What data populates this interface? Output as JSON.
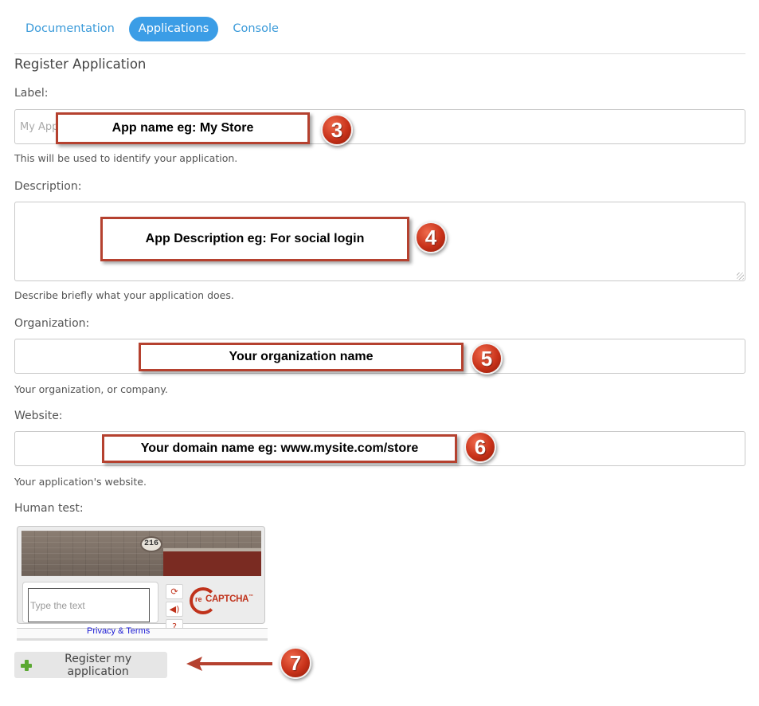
{
  "nav": {
    "tabs": [
      {
        "label": "Documentation",
        "active": false
      },
      {
        "label": "Applications",
        "active": true
      },
      {
        "label": "Console",
        "active": false
      }
    ]
  },
  "form": {
    "section_title": "Register Application",
    "label": {
      "label": "Label:",
      "placeholder": "My App",
      "help": "This will be used to identify your application."
    },
    "description": {
      "label": "Description:",
      "help": "Describe briefly what your application does."
    },
    "organization": {
      "label": "Organization:",
      "help": "Your organization, or company."
    },
    "website": {
      "label": "Website:",
      "help": "Your application's website."
    },
    "human_test": {
      "label": "Human test:",
      "house_number": "216",
      "input_placeholder": "Type the text",
      "logo_text": "reCAPTCHA",
      "logo_prefix": "re",
      "logo_main": "CAPTCHA",
      "logo_tm": "™",
      "privacy_link": "Privacy & Terms",
      "icons": [
        "refresh-icon",
        "audio-icon",
        "help-icon"
      ]
    },
    "submit_label": "Register my application"
  },
  "annotations": [
    {
      "step": "3",
      "text": "App name eg: My Store"
    },
    {
      "step": "4",
      "text": "App Description eg: For social login"
    },
    {
      "step": "5",
      "text": "Your organization name"
    },
    {
      "step": "6",
      "text": "Your domain name eg: www.mysite.com/store"
    },
    {
      "step": "7"
    }
  ],
  "colors": {
    "accent": "#3b9de6",
    "callout_border": "#b5412f",
    "badge": "#c8321a",
    "recaptcha": "#c0321b"
  }
}
